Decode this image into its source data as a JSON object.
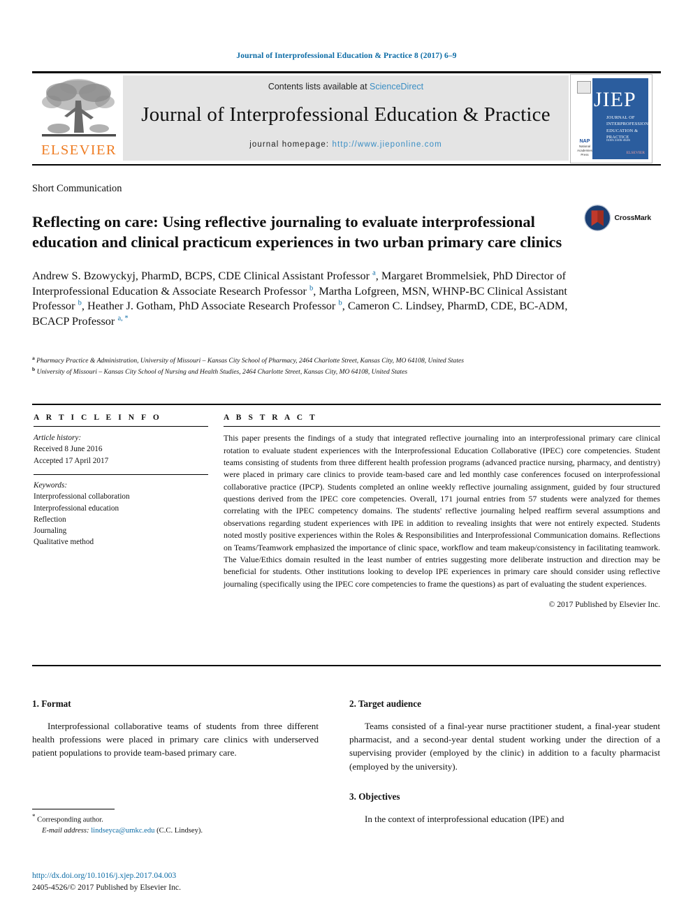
{
  "running_head": "Journal of Interprofessional Education & Practice 8 (2017) 6–9",
  "masthead": {
    "publisher_name": "ELSEVIER",
    "contents_prefix": "Contents lists available at ",
    "contents_link": "ScienceDirect",
    "journal_title": "Journal of Interprofessional Education & Practice",
    "homepage_prefix": "journal homepage: ",
    "homepage_link": "http://www.jieponline.com",
    "cover": {
      "acronym": "JIEP",
      "subtitle": "JOURNAL OF INTERPROFESSIONAL EDUCATION & PRACTICE",
      "issn": "ISSN 2405-4526",
      "nap_label": "NAP",
      "nap_sub": "National Academies Press",
      "publisher_mark": "ELSEVIER"
    }
  },
  "article": {
    "type": "Short Communication",
    "title": "Reflecting on care: Using reflective journaling to evaluate interprofessional education and clinical practicum experiences in two urban primary care clinics",
    "crossmark_label": "CrossMark",
    "authors_html": "Andrew S. Bzowyckyj, PharmD, BCPS, CDE Clinical Assistant Professor <sup>a</sup>, Margaret Brommelsiek, PhD Director of Interprofessional Education &amp; Associate Research Professor <sup>b</sup>, Martha Lofgreen, MSN, WHNP-BC Clinical Assistant Professor <sup>b</sup>, Heather J. Gotham, PhD Associate Research Professor <sup>b</sup>, Cameron C. Lindsey, PharmD, CDE, BC-ADM, BCACP Professor <sup>a, *</sup>",
    "affiliation_a": "Pharmacy Practice & Administration, University of Missouri – Kansas City School of Pharmacy, 2464 Charlotte Street, Kansas City, MO 64108, United States",
    "affiliation_b": "University of Missouri – Kansas City School of Nursing and Health Studies, 2464 Charlotte Street, Kansas City, MO 64108, United States"
  },
  "article_info": {
    "heading": "A R T I C L E   I N F O",
    "history_label": "Article history:",
    "received": "Received 8 June 2016",
    "accepted": "Accepted 17 April 2017",
    "keywords_label": "Keywords:",
    "keywords": [
      "Interprofessional collaboration",
      "Interprofessional education",
      "Reflection",
      "Journaling",
      "Qualitative method"
    ]
  },
  "abstract": {
    "heading": "A B S T R A C T",
    "text": "This paper presents the findings of a study that integrated reflective journaling into an interprofessional primary care clinical rotation to evaluate student experiences with the Interprofessional Education Collaborative (IPEC) core competencies. Student teams consisting of students from three different health profession programs (advanced practice nursing, pharmacy, and dentistry) were placed in primary care clinics to provide team-based care and led monthly case conferences focused on interprofessional collaborative practice (IPCP). Students completed an online weekly reflective journaling assignment, guided by four structured questions derived from the IPEC core competencies. Overall, 171 journal entries from 57 students were analyzed for themes correlating with the IPEC competency domains. The students' reflective journaling helped reaffirm several assumptions and observations regarding student experiences with IPE in addition to revealing insights that were not entirely expected. Students noted mostly positive experiences within the Roles & Responsibilities and Interprofessional Communication domains. Reflections on Teams/Teamwork emphasized the importance of clinic space, workflow and team makeup/consistency in facilitating teamwork. The Value/Ethics domain resulted in the least number of entries suggesting more deliberate instruction and direction may be beneficial for students. Other institutions looking to develop IPE experiences in primary care should consider using reflective journaling (specifically using the IPEC core competencies to frame the questions) as part of evaluating the student experiences.",
    "copyright": "© 2017 Published by Elsevier Inc."
  },
  "body": {
    "section_1_heading": "1. Format",
    "section_1_text": "Interprofessional collaborative teams of students from three different health professions were placed in primary care clinics with underserved patient populations to provide team-based primary care.",
    "section_2_heading": "2. Target audience",
    "section_2_text": "Teams consisted of a final-year nurse practitioner student, a final-year student pharmacist, and a second-year dental student working under the direction of a supervising provider (employed by the clinic) in addition to a faculty pharmacist (employed by the university).",
    "section_3_heading": "3. Objectives",
    "section_3_text": "In the context of interprofessional education (IPE) and"
  },
  "footnotes": {
    "corresponding": "Corresponding author.",
    "email_label": "E-mail address:",
    "email": "lindseyca@umkc.edu",
    "email_owner": "(C.C. Lindsey)."
  },
  "footer": {
    "doi": "http://dx.doi.org/10.1016/j.xjep.2017.04.003",
    "issn_copyright": "2405-4526/© 2017 Published by Elsevier Inc."
  },
  "colors": {
    "link_blue": "#0b6ba5",
    "sciencedirect_blue": "#3a8ec4",
    "elsevier_orange": "#ef7d24",
    "panel_gray": "#e4e4e4"
  }
}
